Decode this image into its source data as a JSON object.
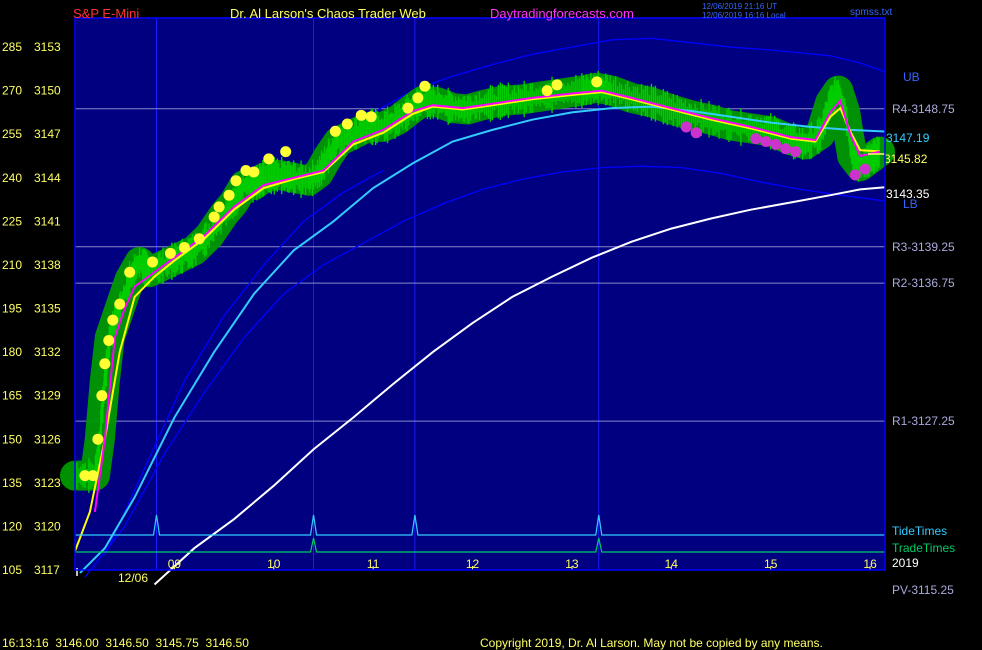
{
  "header": {
    "symbol": "S&P E-Mini",
    "site": "Dr. Al Larson's Chaos Trader Web",
    "url": "Daytradingforecasts.com",
    "time_utc": "12/06/2019 21:16 UT",
    "time_local": "12/06/2019 16:16 Local",
    "file": "spmss.txt"
  },
  "footer": {
    "quote": "16:13:16  3146.00  3146.50  3145.75  3146.50",
    "copyright": "Copyright 2019, Dr. Al Larson. May not be copied by any means."
  },
  "colors": {
    "background": "#000080",
    "frame": "#0000ff",
    "price_bars": "#00cc00",
    "halo": "#009900",
    "dots_yellow": "#ffff33",
    "dots_magenta": "#cc33cc",
    "ma_magenta": "#ff00ff",
    "ma_yellow": "#ffff00",
    "ma_cyan": "#33ccff",
    "ma_white": "#ffffff",
    "band_blue": "#0000ff",
    "tide": "#33ccff",
    "trade": "#00cc66"
  },
  "chart_data": {
    "type": "line",
    "x_unit": "hour of day",
    "x_tick_labels": [
      "09",
      "10",
      "11",
      "12",
      "13",
      "14",
      "15",
      "16"
    ],
    "x_tick_values": [
      9,
      10,
      11,
      12,
      13,
      14,
      15,
      16
    ],
    "date_label": "12/06",
    "year_label": "2019",
    "xlim": [
      8.0,
      16.15
    ],
    "ylim": [
      3117,
      3155
    ],
    "y_ticks": [
      {
        "count": "285",
        "price": "3153",
        "v": 3153
      },
      {
        "count": "270",
        "price": "3150",
        "v": 3150
      },
      {
        "count": "255",
        "price": "3147",
        "v": 3147
      },
      {
        "count": "240",
        "price": "3144",
        "v": 3144
      },
      {
        "count": "225",
        "price": "3141",
        "v": 3141
      },
      {
        "count": "210",
        "price": "3138",
        "v": 3138
      },
      {
        "count": "195",
        "price": "3135",
        "v": 3135
      },
      {
        "count": "180",
        "price": "3132",
        "v": 3132
      },
      {
        "count": "165",
        "price": "3129",
        "v": 3129
      },
      {
        "count": "150",
        "price": "3126",
        "v": 3126
      },
      {
        "count": "135",
        "price": "3123",
        "v": 3123
      },
      {
        "count": "120",
        "price": "3120",
        "v": 3120
      },
      {
        "count": "105",
        "price": "3117",
        "v": 3117
      }
    ],
    "levels": [
      {
        "label": "R4-3148.75",
        "v": 3148.75
      },
      {
        "label": "R3-3139.25",
        "v": 3139.25
      },
      {
        "label": "R2-3136.75",
        "v": 3136.75
      },
      {
        "label": "R1-3127.25",
        "v": 3127.25
      },
      {
        "label": "PV-3115.25",
        "v": 3115.25
      }
    ],
    "band_labels": {
      "upper": "UB",
      "lower": "LB"
    },
    "last_values": [
      {
        "label": "3147.19",
        "v": 3147.19,
        "color": "#33ccff"
      },
      {
        "label": "3145.82",
        "v": 3145.82,
        "color": "#ffff66"
      },
      {
        "label": "3143.35",
        "v": 3143.35,
        "color": "#ffffff"
      }
    ],
    "tide_label": "TideTimes",
    "trade_label": "TradeTimes",
    "tide_spikes": [
      8.82,
      10.4,
      11.42,
      13.27
    ],
    "trade_spikes": [
      10.4,
      13.27
    ],
    "series": [
      {
        "id": "price",
        "points": [
          [
            8.0,
            3123.5
          ],
          [
            8.2,
            3123.5
          ],
          [
            8.25,
            3126
          ],
          [
            8.3,
            3130
          ],
          [
            8.35,
            3133
          ],
          [
            8.45,
            3135
          ],
          [
            8.55,
            3137
          ],
          [
            8.65,
            3138.2
          ],
          [
            8.75,
            3137.5
          ],
          [
            8.9,
            3138
          ],
          [
            9.05,
            3138.5
          ],
          [
            9.2,
            3139
          ],
          [
            9.35,
            3140
          ],
          [
            9.5,
            3141.5
          ],
          [
            9.6,
            3142.3
          ],
          [
            9.7,
            3143.5
          ],
          [
            9.8,
            3143.5
          ],
          [
            9.9,
            3144
          ],
          [
            10.05,
            3144.2
          ],
          [
            10.2,
            3144
          ],
          [
            10.35,
            3143.8
          ],
          [
            10.45,
            3144.3
          ],
          [
            10.55,
            3145.5
          ],
          [
            10.65,
            3146.5
          ],
          [
            10.8,
            3147
          ],
          [
            10.95,
            3147.5
          ],
          [
            11.1,
            3147.5
          ],
          [
            11.25,
            3148
          ],
          [
            11.4,
            3148.8
          ],
          [
            11.5,
            3149.3
          ],
          [
            11.65,
            3149.2
          ],
          [
            11.8,
            3148.8
          ],
          [
            11.95,
            3148.7
          ],
          [
            12.1,
            3149
          ],
          [
            12.3,
            3149.3
          ],
          [
            12.5,
            3149.4
          ],
          [
            12.7,
            3149.6
          ],
          [
            12.9,
            3149.8
          ],
          [
            13.1,
            3150
          ],
          [
            13.25,
            3150.2
          ],
          [
            13.4,
            3150
          ],
          [
            13.6,
            3149.5
          ],
          [
            13.8,
            3149.2
          ],
          [
            14.0,
            3148.7
          ],
          [
            14.2,
            3148.3
          ],
          [
            14.4,
            3148
          ],
          [
            14.6,
            3147.6
          ],
          [
            14.8,
            3147.4
          ],
          [
            15.0,
            3147.2
          ],
          [
            15.2,
            3146.6
          ],
          [
            15.35,
            3146.3
          ],
          [
            15.5,
            3147
          ],
          [
            15.6,
            3149.2
          ],
          [
            15.68,
            3150
          ],
          [
            15.75,
            3148.5
          ],
          [
            15.82,
            3145.5
          ],
          [
            15.9,
            3144.8
          ],
          [
            16.0,
            3145.3
          ],
          [
            16.1,
            3145.8
          ]
        ]
      },
      {
        "id": "ma_magenta",
        "color": "#ff00ff",
        "points": [
          [
            8.2,
            3121
          ],
          [
            8.3,
            3126
          ],
          [
            8.4,
            3133
          ],
          [
            8.5,
            3135
          ],
          [
            8.6,
            3136.5
          ],
          [
            8.8,
            3137.5
          ],
          [
            9.0,
            3138.5
          ],
          [
            9.3,
            3140
          ],
          [
            9.6,
            3142
          ],
          [
            9.9,
            3143.5
          ],
          [
            10.2,
            3144
          ],
          [
            10.5,
            3144.5
          ],
          [
            10.8,
            3146.5
          ],
          [
            11.1,
            3147.3
          ],
          [
            11.4,
            3148.6
          ],
          [
            11.6,
            3149
          ],
          [
            11.9,
            3148.8
          ],
          [
            12.2,
            3149.1
          ],
          [
            12.6,
            3149.5
          ],
          [
            13.0,
            3149.8
          ],
          [
            13.3,
            3150
          ],
          [
            13.6,
            3149.5
          ],
          [
            14.0,
            3148.8
          ],
          [
            14.4,
            3148.1
          ],
          [
            14.8,
            3147.5
          ],
          [
            15.2,
            3146.8
          ],
          [
            15.45,
            3146.6
          ],
          [
            15.6,
            3148.5
          ],
          [
            15.7,
            3149.3
          ],
          [
            15.8,
            3147
          ],
          [
            15.9,
            3145.5
          ],
          [
            16.1,
            3145.8
          ]
        ]
      },
      {
        "id": "ma_yellow",
        "color": "#ffff00",
        "points": [
          [
            8.0,
            3118.3
          ],
          [
            8.15,
            3121
          ],
          [
            8.3,
            3126
          ],
          [
            8.45,
            3132
          ],
          [
            8.6,
            3135.8
          ],
          [
            8.8,
            3137.2
          ],
          [
            9.0,
            3138.3
          ],
          [
            9.3,
            3139.8
          ],
          [
            9.6,
            3141.8
          ],
          [
            9.9,
            3143.3
          ],
          [
            10.2,
            3143.9
          ],
          [
            10.5,
            3144.4
          ],
          [
            10.8,
            3146.3
          ],
          [
            11.1,
            3147.1
          ],
          [
            11.4,
            3148.4
          ],
          [
            11.6,
            3148.9
          ],
          [
            11.9,
            3148.7
          ],
          [
            12.2,
            3149
          ],
          [
            12.6,
            3149.4
          ],
          [
            13.0,
            3149.7
          ],
          [
            13.3,
            3149.9
          ],
          [
            13.6,
            3149.4
          ],
          [
            14.0,
            3148.7
          ],
          [
            14.4,
            3148
          ],
          [
            14.8,
            3147.4
          ],
          [
            15.2,
            3146.7
          ],
          [
            15.45,
            3146.5
          ],
          [
            15.6,
            3148.2
          ],
          [
            15.7,
            3148.8
          ],
          [
            15.8,
            3147.2
          ],
          [
            15.9,
            3145.9
          ],
          [
            16.1,
            3145.82
          ]
        ]
      },
      {
        "id": "ma_cyan",
        "color": "#33ccff",
        "points": [
          [
            8.05,
            3116.8
          ],
          [
            8.3,
            3118.5
          ],
          [
            8.6,
            3122
          ],
          [
            9.0,
            3127.5
          ],
          [
            9.4,
            3132
          ],
          [
            9.8,
            3136
          ],
          [
            10.2,
            3139
          ],
          [
            10.6,
            3141
          ],
          [
            11.0,
            3143.3
          ],
          [
            11.4,
            3145
          ],
          [
            11.8,
            3146.5
          ],
          [
            12.2,
            3147.3
          ],
          [
            12.6,
            3148
          ],
          [
            13.0,
            3148.5
          ],
          [
            13.4,
            3148.8
          ],
          [
            13.8,
            3148.9
          ],
          [
            14.2,
            3148.6
          ],
          [
            14.6,
            3148.2
          ],
          [
            15.0,
            3147.8
          ],
          [
            15.4,
            3147.5
          ],
          [
            15.8,
            3147.3
          ],
          [
            16.15,
            3147.19
          ]
        ]
      },
      {
        "id": "ma_white",
        "color": "#ffffff",
        "points": [
          [
            8.8,
            3116
          ],
          [
            9.2,
            3118.5
          ],
          [
            9.6,
            3120.5
          ],
          [
            10.0,
            3122.8
          ],
          [
            10.4,
            3125.3
          ],
          [
            10.8,
            3127.5
          ],
          [
            11.2,
            3129.8
          ],
          [
            11.6,
            3132
          ],
          [
            12.0,
            3134
          ],
          [
            12.4,
            3135.8
          ],
          [
            12.8,
            3137.2
          ],
          [
            13.2,
            3138.5
          ],
          [
            13.6,
            3139.6
          ],
          [
            14.0,
            3140.5
          ],
          [
            14.4,
            3141.2
          ],
          [
            14.8,
            3141.8
          ],
          [
            15.2,
            3142.3
          ],
          [
            15.6,
            3142.8
          ],
          [
            15.9,
            3143.2
          ],
          [
            16.15,
            3143.35
          ]
        ]
      },
      {
        "id": "band_upper_outer",
        "color": "#0000ff",
        "points": [
          [
            11.0,
            3148.5
          ],
          [
            11.4,
            3150
          ],
          [
            11.8,
            3151
          ],
          [
            12.2,
            3151.8
          ],
          [
            12.6,
            3152.5
          ],
          [
            13.0,
            3153
          ],
          [
            13.4,
            3153.5
          ],
          [
            13.8,
            3153.6
          ],
          [
            14.2,
            3153.3
          ],
          [
            14.6,
            3153
          ],
          [
            15.0,
            3152.8
          ],
          [
            15.3,
            3152.6
          ],
          [
            15.6,
            3152.4
          ],
          [
            15.9,
            3151.9
          ],
          [
            16.15,
            3151.3
          ]
        ]
      },
      {
        "id": "band_lower_outer",
        "color": "#0000ff",
        "points": [
          [
            8.1,
            3116.5
          ],
          [
            8.5,
            3120
          ],
          [
            8.9,
            3125
          ],
          [
            9.3,
            3129.2
          ],
          [
            9.7,
            3133
          ],
          [
            10.1,
            3136
          ],
          [
            10.5,
            3138
          ],
          [
            10.9,
            3139.5
          ],
          [
            11.3,
            3141
          ],
          [
            11.7,
            3142.2
          ],
          [
            12.1,
            3143.2
          ],
          [
            12.5,
            3143.9
          ],
          [
            12.9,
            3144.4
          ],
          [
            13.3,
            3144.7
          ],
          [
            13.7,
            3144.8
          ],
          [
            14.1,
            3144.7
          ],
          [
            14.5,
            3144.3
          ],
          [
            14.9,
            3143.7
          ],
          [
            15.3,
            3143.2
          ],
          [
            15.7,
            3142.8
          ],
          [
            16.15,
            3142.4
          ]
        ]
      },
      {
        "id": "band_inner",
        "color": "#0000ff",
        "points": [
          [
            8.3,
            3118
          ],
          [
            8.7,
            3124
          ],
          [
            9.1,
            3130
          ],
          [
            9.5,
            3134.5
          ],
          [
            9.9,
            3138
          ],
          [
            10.3,
            3141
          ],
          [
            10.7,
            3143
          ],
          [
            11.1,
            3144.5
          ]
        ]
      }
    ],
    "dots_yellow": [
      [
        8.1,
        3123.5
      ],
      [
        8.18,
        3123.5
      ],
      [
        8.23,
        3126
      ],
      [
        8.27,
        3129
      ],
      [
        8.3,
        3131.2
      ],
      [
        8.34,
        3132.8
      ],
      [
        8.38,
        3134.2
      ],
      [
        8.45,
        3135.3
      ],
      [
        8.55,
        3137.5
      ],
      [
        8.78,
        3138.2
      ],
      [
        8.96,
        3138.8
      ],
      [
        9.1,
        3139.2
      ],
      [
        9.25,
        3139.8
      ],
      [
        9.4,
        3141.3
      ],
      [
        9.45,
        3142
      ],
      [
        9.55,
        3142.8
      ],
      [
        9.62,
        3143.8
      ],
      [
        9.72,
        3144.5
      ],
      [
        9.8,
        3144.4
      ],
      [
        9.95,
        3145.3
      ],
      [
        10.12,
        3145.8
      ],
      [
        10.62,
        3147.2
      ],
      [
        10.74,
        3147.7
      ],
      [
        10.88,
        3148.3
      ],
      [
        10.98,
        3148.2
      ],
      [
        11.35,
        3148.8
      ],
      [
        11.45,
        3149.5
      ],
      [
        11.52,
        3150.3
      ],
      [
        12.75,
        3150
      ],
      [
        12.85,
        3150.4
      ],
      [
        13.25,
        3150.6
      ]
    ],
    "dots_magenta": [
      [
        14.15,
        3147.5
      ],
      [
        14.25,
        3147.1
      ],
      [
        14.85,
        3146.7
      ],
      [
        14.95,
        3146.5
      ],
      [
        15.05,
        3146.3
      ],
      [
        15.15,
        3146
      ],
      [
        15.25,
        3145.8
      ],
      [
        15.85,
        3144.2
      ],
      [
        15.95,
        3144.6
      ]
    ]
  }
}
